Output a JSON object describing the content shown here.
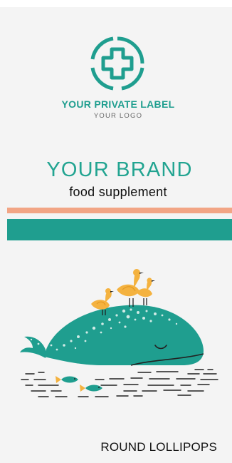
{
  "label": {
    "private_label": "YOUR PRIVATE LABEL",
    "logo_caption": "YOUR LOGO",
    "brand": "YOUR BRAND",
    "category": "food supplement",
    "product": "ROUND LOLLIPOPS"
  },
  "colors": {
    "teal": "#1f9e8f",
    "orange_stripe": "#f2a585",
    "bird_yellow": "#f4b23f",
    "background": "#f4f4f4"
  },
  "icons": {
    "logo": "medical-cross-icon",
    "illustration": "whale-with-birds"
  }
}
